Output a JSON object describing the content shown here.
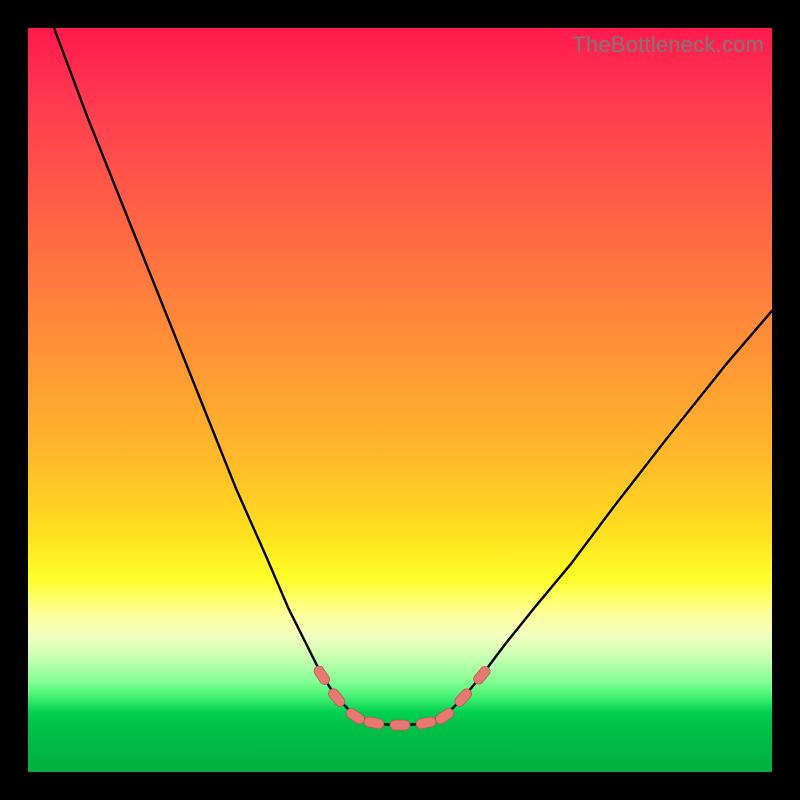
{
  "watermark": "TheBottleneck.com",
  "chart_data": {
    "type": "line",
    "title": "",
    "xlabel": "",
    "ylabel": "",
    "xlim": [
      0,
      100
    ],
    "ylim": [
      0,
      100
    ],
    "series": [
      {
        "name": "curve-left",
        "x": [
          3.5,
          8,
          12,
          16,
          20,
          24,
          28,
          32,
          35,
          37.5,
          39.5,
          41.5,
          44
        ],
        "values": [
          100,
          88,
          78,
          68,
          58,
          48,
          38,
          29,
          22,
          17,
          13,
          10,
          7.5
        ]
      },
      {
        "name": "curve-bottom",
        "x": [
          44,
          46,
          48,
          50,
          52,
          54,
          56
        ],
        "values": [
          7.5,
          6.8,
          6.4,
          6.3,
          6.4,
          6.8,
          7.5
        ]
      },
      {
        "name": "curve-right",
        "x": [
          56,
          58.5,
          61,
          64,
          68,
          73,
          79,
          86,
          94,
          100
        ],
        "values": [
          7.5,
          10,
          13,
          17,
          22,
          28,
          36,
          45,
          55,
          62
        ]
      }
    ],
    "markers": {
      "name": "highlight-points",
      "shape": "capsule",
      "color": "#e67a72",
      "points": [
        {
          "x": 39.5,
          "y": 13
        },
        {
          "x": 41.5,
          "y": 10
        },
        {
          "x": 44,
          "y": 7.5
        },
        {
          "x": 46.5,
          "y": 6.6
        },
        {
          "x": 50,
          "y": 6.3
        },
        {
          "x": 53.5,
          "y": 6.6
        },
        {
          "x": 56,
          "y": 7.5
        },
        {
          "x": 58.5,
          "y": 10
        },
        {
          "x": 61,
          "y": 13
        }
      ]
    },
    "background_gradient": {
      "direction": "top-to-bottom",
      "stops": [
        {
          "pos": 0,
          "color": "#ff1a4d"
        },
        {
          "pos": 68,
          "color": "#ffe020"
        },
        {
          "pos": 74,
          "color": "#ffff2a"
        },
        {
          "pos": 88,
          "color": "#80ff90"
        },
        {
          "pos": 100,
          "color": "#00b040"
        }
      ]
    }
  }
}
